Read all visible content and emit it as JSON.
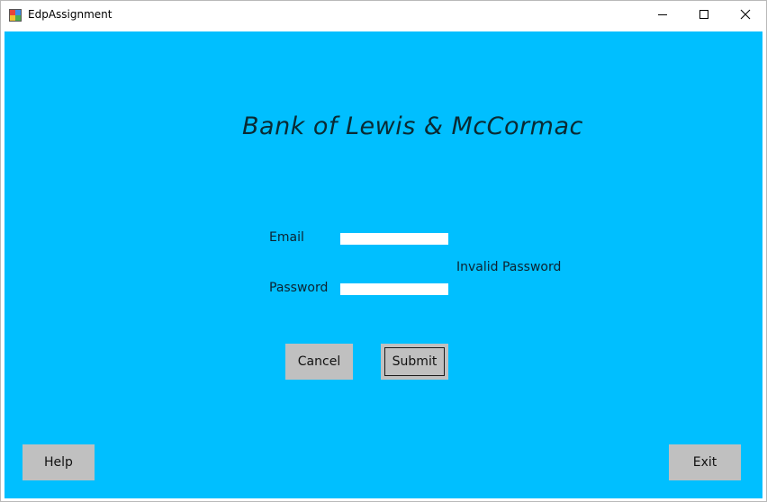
{
  "window": {
    "title": "EdpAssignment",
    "app_icon": "winforms-app-icon",
    "controls": {
      "minimize_icon": "minimize-icon",
      "maximize_icon": "maximize-icon",
      "close_icon": "close-icon"
    }
  },
  "form": {
    "background_color": "#00bfff",
    "heading": "Bank of Lewis & McCormac",
    "email": {
      "label": "Email",
      "value": ""
    },
    "password": {
      "label": "Password",
      "value": ""
    },
    "error_message": "Invalid Password",
    "buttons": {
      "cancel": "Cancel",
      "submit": "Submit",
      "help": "Help",
      "exit": "Exit"
    },
    "button_color": "#c0c0c0"
  }
}
